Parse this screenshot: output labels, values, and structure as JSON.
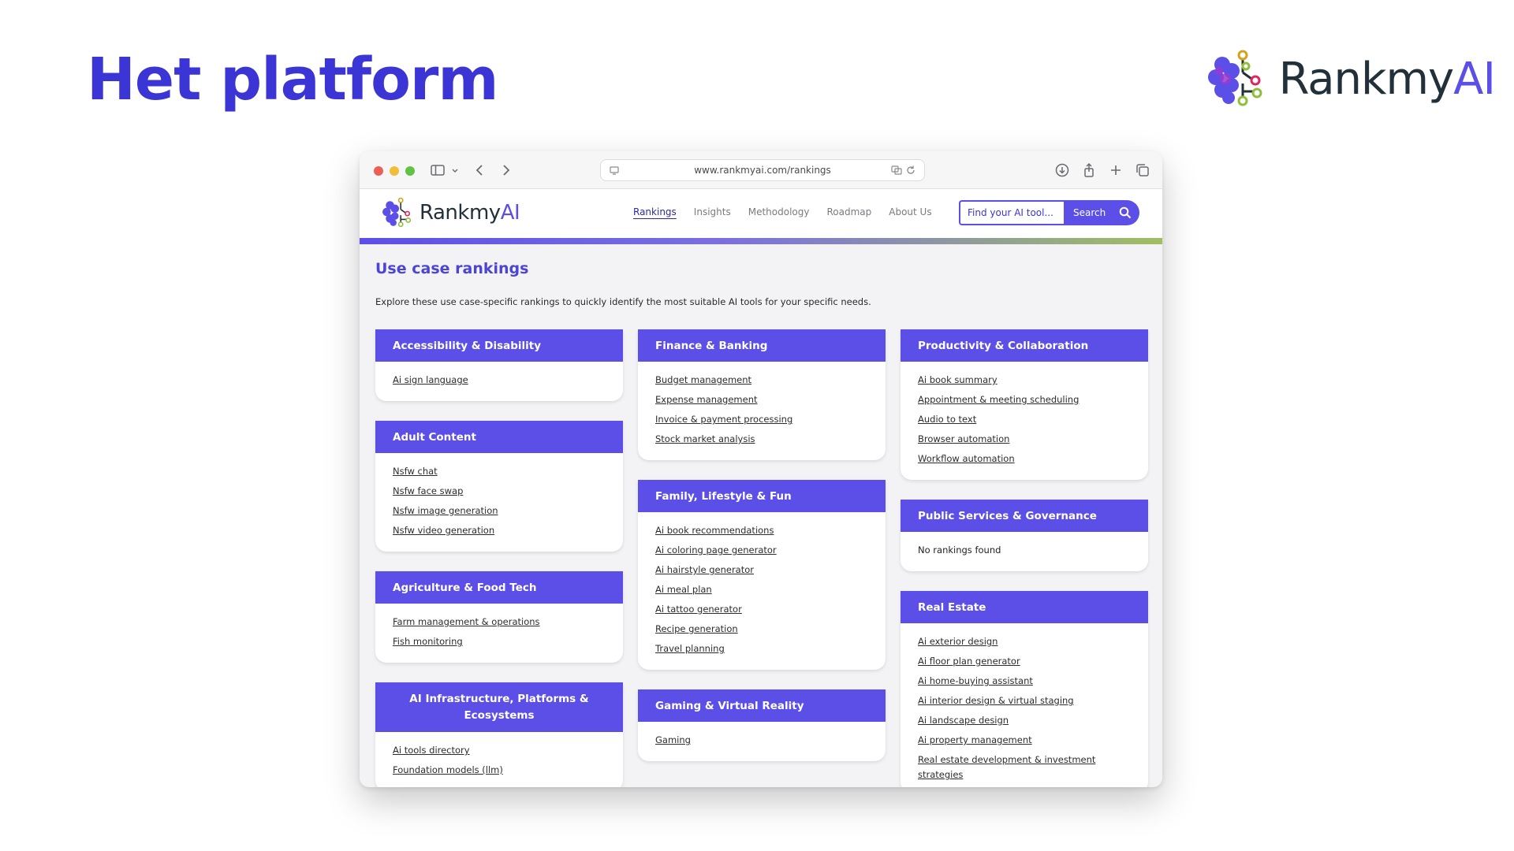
{
  "slide": {
    "title": "Het platform",
    "logo_text_1": "Rankmy",
    "logo_text_2": "AI"
  },
  "browser": {
    "url": "www.rankmyai.com/rankings"
  },
  "site": {
    "logo_text_1": "Rankmy",
    "logo_text_2": "AI",
    "nav": [
      "Rankings",
      "Insights",
      "Methodology",
      "Roadmap",
      "About Us"
    ],
    "search_placeholder": "Find your AI tool...",
    "search_button": "Search"
  },
  "page": {
    "title": "Use case rankings",
    "description": "Explore these use case-specific rankings to quickly identify the most suitable AI tools for your specific needs."
  },
  "columns": [
    [
      {
        "title": "Accessibility & Disability",
        "items": [
          "Ai sign language"
        ]
      },
      {
        "title": "Adult Content",
        "items": [
          "Nsfw chat",
          "Nsfw face swap",
          "Nsfw image generation",
          "Nsfw video generation"
        ]
      },
      {
        "title": "Agriculture & Food Tech",
        "items": [
          "Farm management & operations",
          "Fish monitoring"
        ]
      },
      {
        "title": "AI Infrastructure, Platforms & Ecosystems",
        "items": [
          "Ai tools directory",
          "Foundation models (llm)"
        ]
      }
    ],
    [
      {
        "title": "Finance & Banking",
        "items": [
          "Budget management",
          "Expense management",
          "Invoice & payment processing",
          "Stock market analysis"
        ]
      },
      {
        "title": "Family, Lifestyle & Fun",
        "items": [
          "Ai book recommendations",
          "Ai coloring page generator",
          "Ai hairstyle generator",
          "Ai meal plan",
          "Ai tattoo generator",
          "Recipe generation",
          "Travel planning"
        ]
      },
      {
        "title": "Gaming & Virtual Reality",
        "items": [
          "Gaming"
        ]
      }
    ],
    [
      {
        "title": "Productivity & Collaboration",
        "items": [
          "Ai book summary",
          "Appointment & meeting scheduling",
          "Audio to text",
          "Browser automation",
          "Workflow automation"
        ]
      },
      {
        "title": "Public Services & Governance",
        "items": [],
        "empty_text": "No rankings found"
      },
      {
        "title": "Real Estate",
        "items": [
          "Ai exterior design",
          "Ai floor plan generator",
          "Ai home-buying assistant",
          "Ai interior design & virtual staging",
          "Ai landscape design",
          "Ai property management",
          "Real estate development & investment",
          "strategies"
        ]
      }
    ]
  ],
  "colors": {
    "brand": "#5b4fe8",
    "title": "#3b35d6",
    "gradient_end": "#9fbf63"
  }
}
